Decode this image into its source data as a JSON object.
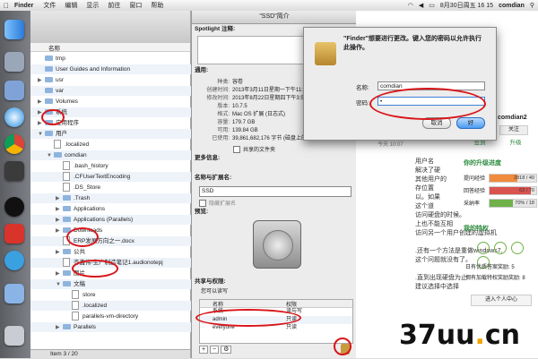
{
  "menubar": {
    "app": "Finder",
    "items": [
      "文件",
      "编辑",
      "显示",
      "前往",
      "窗口",
      "帮助"
    ],
    "date_time": "8月30日周五 16 15",
    "user": "comdian"
  },
  "finder": {
    "column_header": "名称",
    "rows": [
      {
        "label": "tmp",
        "type": "folder",
        "indent": 0,
        "tri": ""
      },
      {
        "label": "User Guides and Information",
        "type": "folder",
        "indent": 0,
        "tri": ""
      },
      {
        "label": "usr",
        "type": "folder",
        "indent": 0,
        "tri": "▶"
      },
      {
        "label": "var",
        "type": "folder",
        "indent": 0,
        "tri": ""
      },
      {
        "label": "Volumes",
        "type": "folder",
        "indent": 0,
        "tri": "▶"
      },
      {
        "label": "系统",
        "type": "folder",
        "indent": 0,
        "tri": "▶"
      },
      {
        "label": "应用程序",
        "type": "folder",
        "indent": 0,
        "tri": "▶"
      },
      {
        "label": "用户",
        "type": "folder",
        "indent": 0,
        "tri": "▼"
      },
      {
        "label": ".localized",
        "type": "doc",
        "indent": 1,
        "tri": ""
      },
      {
        "label": "comdian",
        "type": "folder",
        "indent": 1,
        "tri": "▼"
      },
      {
        "label": ".bash_history",
        "type": "doc",
        "indent": 2,
        "tri": ""
      },
      {
        "label": ".CFUserTextEncoding",
        "type": "doc",
        "indent": 2,
        "tri": ""
      },
      {
        "label": ".DS_Store",
        "type": "doc",
        "indent": 2,
        "tri": ""
      },
      {
        "label": ".Trash",
        "type": "folder",
        "indent": 2,
        "tri": "▶"
      },
      {
        "label": "Applications",
        "type": "folder",
        "indent": 2,
        "tri": "▶"
      },
      {
        "label": "Applications (Parallels)",
        "type": "folder",
        "indent": 2,
        "tri": "▶"
      },
      {
        "label": "Downloads",
        "type": "folder",
        "indent": 2,
        "tri": "▶"
      },
      {
        "label": "ERP发展方向之一.docx",
        "type": "doc",
        "indent": 2,
        "tri": ""
      },
      {
        "label": "公共",
        "type": "folder",
        "indent": 2,
        "tri": "▶"
      },
      {
        "label": "齐鑫伟-生产制造笔记1.audionotepj",
        "type": "doc",
        "indent": 2,
        "tri": ""
      },
      {
        "label": "图片",
        "type": "folder",
        "indent": 2,
        "tri": "▶"
      },
      {
        "label": "文稿",
        "type": "folder",
        "indent": 2,
        "tri": "▼"
      },
      {
        "label": "store",
        "type": "doc",
        "indent": 3,
        "tri": ""
      },
      {
        "label": ".localized",
        "type": "doc",
        "indent": 3,
        "tri": ""
      },
      {
        "label": "parallels-vm-directory",
        "type": "doc",
        "indent": 3,
        "tri": ""
      },
      {
        "label": "Parallels",
        "type": "folder",
        "indent": 2,
        "tri": "▶"
      }
    ],
    "status": "Item 3 / 20"
  },
  "info": {
    "title": "\"SSD\"简介",
    "spotlight_label": "Spotlight 注释:",
    "general_header": "通用:",
    "general": [
      {
        "k": "种类:",
        "v": "容卷"
      },
      {
        "k": "创建时间:",
        "v": "2013年3月11日星期一下午11:05"
      },
      {
        "k": "修改时间:",
        "v": "2013年8月22日星期四下午3:55"
      },
      {
        "k": "版本:",
        "v": "10.7.5"
      },
      {
        "k": "格式:",
        "v": "Mac OS 扩展 (日志式)"
      },
      {
        "k": "容量:",
        "v": "179.7 GB"
      },
      {
        "k": "可用:",
        "v": "139.84 GB"
      },
      {
        "k": "已使用:",
        "v": "39,861,682,176 字节 (磁盘上的 39.8"
      }
    ],
    "shared_folder": "共享的文件夹",
    "more_info": "更多信息:",
    "name_ext": "名称与扩展名:",
    "name_value": "SSD",
    "hide_ext": "隐藏扩展名",
    "preview": "预览:",
    "sharing": "共享与权限:",
    "sharing_note": "您可以读写",
    "perm_headers": [
      "名称",
      "权限"
    ],
    "perms": [
      {
        "name": "系统",
        "priv": "读与写"
      },
      {
        "name": "admin",
        "priv": "只读"
      },
      {
        "name": "everyone",
        "priv": "只读"
      }
    ]
  },
  "dialog": {
    "message": "\"Finder\"想要进行更改。键入您的密码以允许执行此操作。",
    "name_label": "名称:",
    "name_value": "comdian",
    "password_label": "密码:",
    "password_value": "•",
    "cancel": "取消",
    "ok": "好"
  },
  "web": {
    "user": "comdian2",
    "follow": "关注",
    "sign": "签到",
    "upgrade": "升级",
    "section_upgrade": "你的升级进度",
    "progress": [
      {
        "label": "提问经验",
        "value": "2818 / 40",
        "fill": 0.6
      },
      {
        "label": "回答经验",
        "value": "62 / 70",
        "fill": 0.88
      },
      {
        "label": "采纳率",
        "value": "70% / 18",
        "fill": 0.5
      }
    ],
    "section_privilege": "我的特权",
    "priv_1": "日有优质答案奖励: 5",
    "priv_2": "拥有加载特权奖励奖励: 8",
    "enter_btn": "进入个人中心",
    "body_lines": [
      "用户名",
      "解决了硬",
      "其他用户的",
      "存位置",
      "以。如果",
      "这个道",
      "访问硬盘的时候。",
      "上也不能互相",
      "访问另一个用户创建的虚拟机",
      "",
      ".还有一个方法是重做windows7,",
      "这个问题就没有了。",
      "",
      ".直到出现硬盘为止",
      "建议选择中选择"
    ],
    "timestamp": "今天 10:07"
  },
  "watermark": {
    "a": "37uu",
    "dot": ".",
    "b": "cn"
  }
}
